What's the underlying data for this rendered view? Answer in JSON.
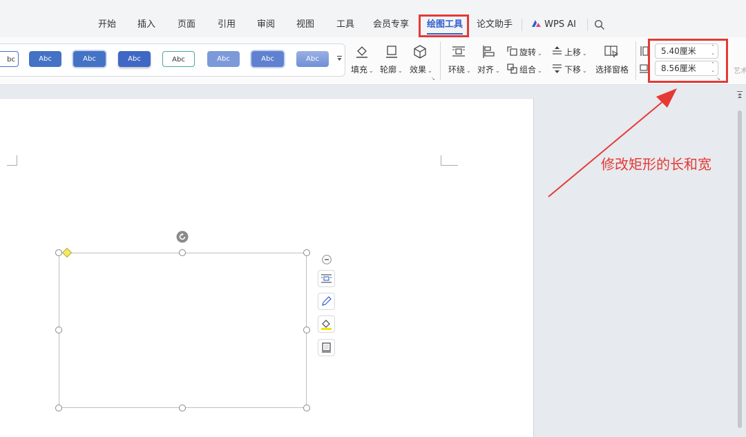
{
  "tabs": [
    {
      "label": "开始"
    },
    {
      "label": "插入"
    },
    {
      "label": "页面"
    },
    {
      "label": "引用"
    },
    {
      "label": "审阅"
    },
    {
      "label": "视图"
    },
    {
      "label": "工具"
    },
    {
      "label": "会员专享"
    },
    {
      "label": "绘图工具",
      "active": true
    },
    {
      "label": "论文助手"
    },
    {
      "label": "WPS AI"
    }
  ],
  "search_icon": "search-icon",
  "style_gallery": {
    "items": [
      "bc",
      "Abc",
      "Abc",
      "Abc",
      "Abc",
      "Abc",
      "Abc",
      "Abc"
    ],
    "more_icon": "chevron-down-icon"
  },
  "format_group": {
    "fill": "填充",
    "outline": "轮廓",
    "effect": "效果"
  },
  "arrange_group": {
    "wrap": "环绕",
    "align": "对齐",
    "rotate": "旋转",
    "group": "组合",
    "bring_forward": "上移",
    "send_backward": "下移",
    "selection_pane": "选择窗格"
  },
  "size_group": {
    "height": "5.40厘米",
    "width": "8.56厘米",
    "art_text": "艺术"
  },
  "annotation": {
    "text": "修改矩形的长和宽",
    "color": "#e53935"
  },
  "colors": {
    "accent": "#2f5fd0",
    "highlight": "#e53935",
    "style_fill": "#4472c4"
  }
}
